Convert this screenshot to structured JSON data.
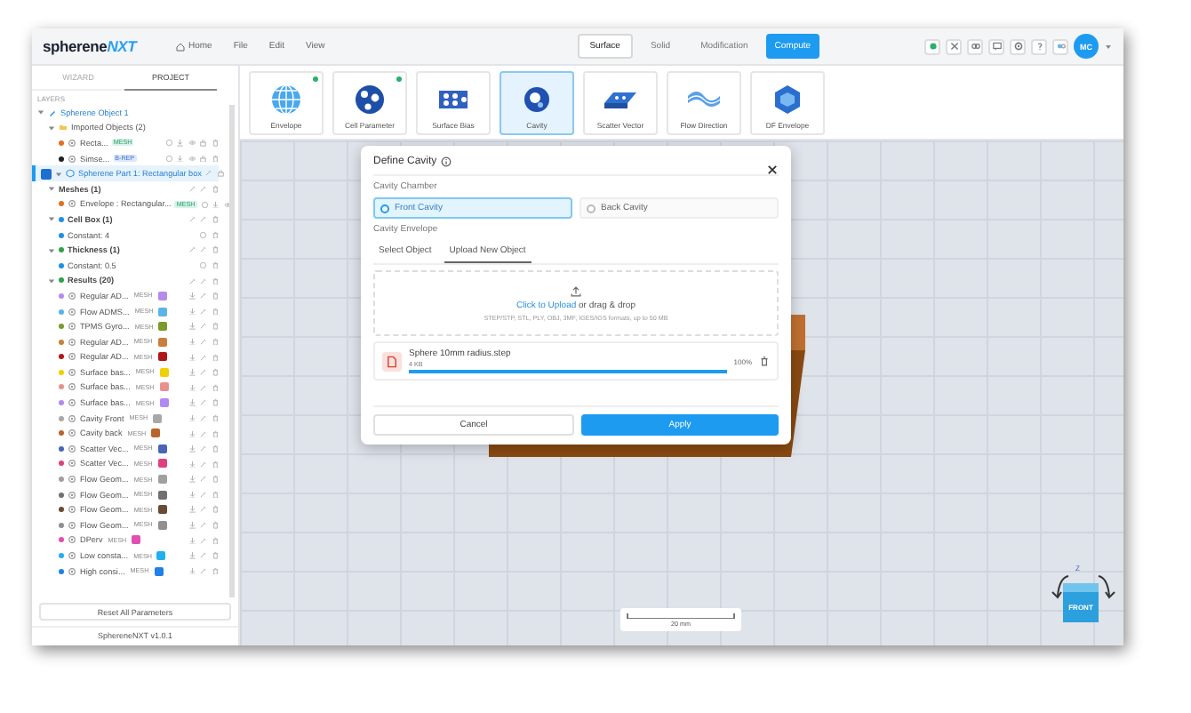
{
  "app": {
    "logo": "spherene",
    "logo_accent": "NXT"
  },
  "menu": [
    {
      "label": "Home",
      "kind": "home"
    },
    {
      "label": "File",
      "kind": "plain"
    },
    {
      "label": "Edit",
      "kind": "plain"
    },
    {
      "label": "View",
      "kind": "plain"
    }
  ],
  "mode_tabs": [
    {
      "label": "Surface",
      "selected": true
    },
    {
      "label": "Solid",
      "selected": false
    },
    {
      "label": "Modification",
      "selected": false
    }
  ],
  "compute_button": "Compute",
  "user": {
    "initials": "MC"
  },
  "sidebar": {
    "tabs": [
      {
        "label": "WIZARD",
        "selected": false
      },
      {
        "label": "PROJECT",
        "selected": true
      }
    ],
    "section_label": "LAYERS",
    "tree": [
      {
        "kind": "object",
        "label": "Spherene Object 1",
        "selected": false,
        "expanded": true,
        "children": [
          {
            "kind": "folder",
            "label": "Imported Objects (2)",
            "selected": false,
            "expanded": true,
            "children": [
              {
                "kind": "item",
                "label": "Recta...",
                "color": "#e07020",
                "tag": "MESH",
                "selected": false
              },
              {
                "kind": "item",
                "label": "Simse...",
                "color": "#202020",
                "tag": "B-REP",
                "selected": false
              }
            ]
          }
        ]
      },
      {
        "kind": "part",
        "label": "Spherene Part 1: Rectangular box",
        "selected": true,
        "expanded": true,
        "children": [
          {
            "kind": "group",
            "label": "Meshes (1)",
            "selected": false,
            "expanded": true,
            "children": [
              {
                "kind": "item",
                "label": "Envelope : Rectangular...",
                "color": "#e07020",
                "tag": "MESH",
                "selected": false
              }
            ]
          },
          {
            "kind": "group",
            "label": "Cell Box (1)",
            "color": "#2090e0",
            "selected": false,
            "expanded": true,
            "children": [
              {
                "kind": "param",
                "label": "Constant: 4",
                "color": "#2090e0",
                "selected": false
              }
            ]
          },
          {
            "kind": "group",
            "label": "Thickness (1)",
            "color": "#30a050",
            "selected": false,
            "expanded": true,
            "children": [
              {
                "kind": "param",
                "label": "Constant: 0.5",
                "color": "#2090e0",
                "selected": false
              }
            ]
          },
          {
            "kind": "group",
            "label": "Results (20)",
            "color": "#30a050",
            "selected": false,
            "expanded": true,
            "children": [
              {
                "kind": "result",
                "label": "Regular AD...",
                "tag": "MESH",
                "color": "#b58ae8",
                "selected": false
              },
              {
                "kind": "result",
                "label": "Flow ADMS...",
                "tag": "MESH",
                "color": "#5ab4e8",
                "selected": false
              },
              {
                "kind": "result",
                "label": "TPMS Gyro...",
                "tag": "MESH",
                "color": "#7a9a2a",
                "selected": false
              },
              {
                "kind": "result",
                "label": "Regular AD...",
                "tag": "MESH",
                "color": "#c87f3a",
                "selected": false
              },
              {
                "kind": "result",
                "label": "Regular AD...",
                "tag": "MESH",
                "color": "#b01818",
                "selected": false
              },
              {
                "kind": "result",
                "label": "Surface bas...",
                "tag": "MESH",
                "color": "#f0d000",
                "selected": false
              },
              {
                "kind": "result",
                "label": "Surface bas...",
                "tag": "MESH",
                "color": "#e89090",
                "selected": false
              },
              {
                "kind": "result",
                "label": "Surface bas...",
                "tag": "MESH",
                "color": "#b08af0",
                "selected": false
              },
              {
                "kind": "result",
                "label": "Cavity Front",
                "tag": "MESH",
                "color": "#a8a8a8",
                "selected": false
              },
              {
                "kind": "result",
                "label": "Cavity back",
                "tag": "MESH",
                "color": "#b8642a",
                "selected": false
              },
              {
                "kind": "result",
                "label": "Scatter Vec...",
                "tag": "MESH",
                "color": "#4a64b8",
                "selected": false
              },
              {
                "kind": "result",
                "label": "Scatter Vec...",
                "tag": "MESH",
                "color": "#e04080",
                "selected": false
              },
              {
                "kind": "result",
                "label": "Flow Geom...",
                "tag": "MESH",
                "color": "#a0a0a0",
                "selected": false
              },
              {
                "kind": "result",
                "label": "Flow Geom...",
                "tag": "MESH",
                "color": "#707070",
                "selected": false
              },
              {
                "kind": "result",
                "label": "Flow Geom...",
                "tag": "MESH",
                "color": "#6a4a32",
                "selected": false
              },
              {
                "kind": "result",
                "label": "Flow Geom...",
                "tag": "MESH",
                "color": "#909090",
                "selected": false
              },
              {
                "kind": "result",
                "label": "DPerv",
                "tag": "MESH",
                "color": "#e050b0",
                "selected": false
              },
              {
                "kind": "result",
                "label": "Low consta...",
                "tag": "MESH",
                "color": "#20b0f0",
                "selected": false
              },
              {
                "kind": "result",
                "label": "High consi...",
                "tag": "MESH",
                "color": "#2080e8",
                "selected": false
              }
            ]
          }
        ]
      }
    ],
    "reset_button": "Reset All Parameters",
    "version": "SphereneNXT v1.0.1"
  },
  "tools": [
    {
      "label": "Envelope",
      "kind": "globe",
      "selected": false,
      "badge": true
    },
    {
      "label": "Cell Parameter",
      "kind": "sphere",
      "selected": false,
      "badge": true
    },
    {
      "label": "Surface Bias",
      "kind": "lattice",
      "selected": false,
      "badge": false
    },
    {
      "label": "Cavity",
      "kind": "cavity",
      "selected": true,
      "badge": false
    },
    {
      "label": "Scatter Vector",
      "kind": "slab",
      "selected": false,
      "badge": false
    },
    {
      "label": "Flow Direction",
      "kind": "wave",
      "selected": false,
      "badge": false
    },
    {
      "label": "DF Envelope",
      "kind": "cube",
      "selected": false,
      "badge": false
    }
  ],
  "dialog": {
    "title": "Define Cavity",
    "chamber_label": "Cavity Chamber",
    "chambers": [
      {
        "label": "Front Cavity",
        "selected": true
      },
      {
        "label": "Back Cavity",
        "selected": false
      }
    ],
    "envelope_label": "Cavity Envelope",
    "tabs": [
      {
        "label": "Select Object",
        "selected": false
      },
      {
        "label": "Upload New Object",
        "selected": true
      }
    ],
    "upload_link": "Click to Upload",
    "upload_text": " or drag & drop",
    "upload_hint": "STEP/STP, STL, PLY, OBJ, 3MF, IGES/IGS formats, up to 50 MB",
    "file": {
      "name": "Sphere 10mm radius.step",
      "size": "4 KB",
      "level": 1,
      "percent": "100%"
    },
    "buttons": [
      {
        "label": "Cancel",
        "kind": "secondary"
      },
      {
        "label": "Apply",
        "kind": "primary"
      }
    ]
  },
  "scale_label": "20 mm",
  "nav_cube": {
    "face": "FRONT",
    "axis_z": "Z"
  }
}
